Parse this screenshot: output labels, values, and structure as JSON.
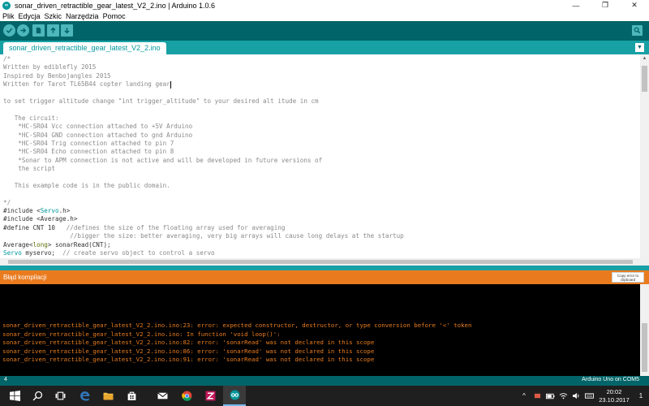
{
  "window": {
    "title": "sonar_driven_retractible_gear_latest_V2_2.ino | Arduino 1.0.6",
    "minimize": "—",
    "restore": "❐",
    "close": "✕"
  },
  "menu": [
    "Plik",
    "Edycja",
    "Szkic",
    "Narzędzia",
    "Pomoc"
  ],
  "tab": {
    "label": "sonar_driven_retractible_gear_latest_V2_2.ino",
    "menu_glyph": "▼"
  },
  "code": [
    {
      "cls": "cm",
      "text": "/*"
    },
    {
      "cls": "cm",
      "text": "Written by ediblefly 2015"
    },
    {
      "cls": "cm",
      "text": "Inspired by Benbojangles 2015"
    },
    {
      "cls": "cm",
      "text": "Written for Tarot TL65B44 copter landing gear",
      "cursor": true
    },
    {
      "cls": "cm",
      "text": ""
    },
    {
      "cls": "cm",
      "text": "to set trigger altitude change \"int trigger_altitude\" to your desired alt itude in cm"
    },
    {
      "cls": "cm",
      "text": ""
    },
    {
      "cls": "cm",
      "text": "   The circuit:"
    },
    {
      "cls": "cm",
      "text": "    *HC-SR04 Vcc connection attached to +5V Arduino"
    },
    {
      "cls": "cm",
      "text": "    *HC-SR04 GND connection attached to gnd Arduino"
    },
    {
      "cls": "cm",
      "text": "    *HC-SR04 Trig connection attached to pin 7"
    },
    {
      "cls": "cm",
      "text": "    *HC-SR04 Echo connection attached to pin 8"
    },
    {
      "cls": "cm",
      "text": "    *Sonar to APM connection is not active and will be developed in future versions of"
    },
    {
      "cls": "cm",
      "text": "    the script"
    },
    {
      "cls": "cm",
      "text": ""
    },
    {
      "cls": "cm",
      "text": "   This example code is in the public domain."
    },
    {
      "cls": "cm",
      "text": ""
    },
    {
      "cls": "cm",
      "text": "*/"
    },
    {
      "parts": [
        {
          "cls": "tx",
          "text": "#include <"
        },
        {
          "cls": "tp",
          "text": "Servo"
        },
        {
          "cls": "tx",
          "text": ".h>"
        }
      ]
    },
    {
      "parts": [
        {
          "cls": "tx",
          "text": "#include <Average.h>"
        }
      ]
    },
    {
      "parts": [
        {
          "cls": "tx",
          "text": "#define CNT 10   "
        },
        {
          "cls": "cm",
          "text": "//defines the size of the floating array used for averaging"
        }
      ]
    },
    {
      "parts": [
        {
          "cls": "cm",
          "text": "                  //bigger the size: better averaging, very big arrays will cause long delays at the startup"
        }
      ]
    },
    {
      "parts": [
        {
          "cls": "tx",
          "text": "Average<"
        },
        {
          "cls": "kw",
          "text": "long"
        },
        {
          "cls": "tx",
          "text": "> sonarRead(CNT);"
        }
      ]
    },
    {
      "parts": [
        {
          "cls": "tp",
          "text": "Servo"
        },
        {
          "cls": "tx",
          "text": " myservo;  "
        },
        {
          "cls": "cm",
          "text": "// create servo object to control a servo"
        }
      ]
    }
  ],
  "message_bar": {
    "text": "Błąd kompilacji",
    "copy_button": "Copy error to clipboard"
  },
  "console": [
    "sonar_driven_retractible_gear_latest_V2_2.ino.ino:23: error: expected constructor, destructor, or type conversion before '<' token",
    "sonar_driven_retractible_gear_latest_V2_2.ino.ino: In function 'void loop()':",
    "sonar_driven_retractible_gear_latest_V2_2.ino.ino:82: error: 'sonarRead' was not declared in this scope",
    "sonar_driven_retractible_gear_latest_V2_2.ino.ino:86: error: 'sonarRead' was not declared in this scope",
    "sonar_driven_retractible_gear_latest_V2_2.ino.ino:91: error: 'sonarRead' was not declared in this scope"
  ],
  "status": {
    "line": "4",
    "board": "Arduino Uno on COM5"
  },
  "taskbar": {
    "time": "20:02",
    "date": "23.10.2017",
    "notification_count": "1"
  },
  "colors": {
    "toolbar": "#006468",
    "tabstrip": "#17a1a5",
    "error_bar": "#e97b1e",
    "console_text": "#e87d1f"
  }
}
